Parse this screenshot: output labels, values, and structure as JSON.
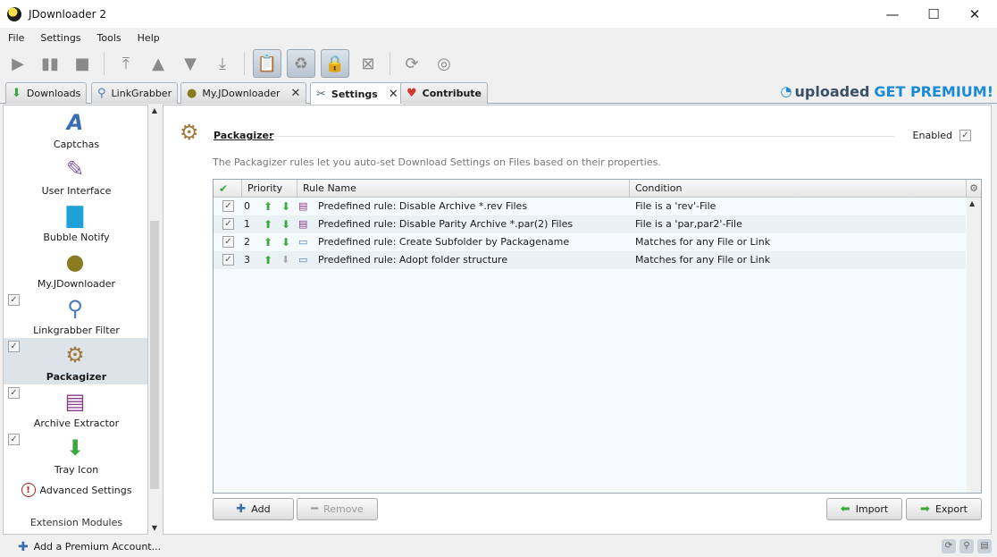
{
  "window": {
    "title": "JDownloader 2",
    "minimize": "—",
    "maximize": "☐",
    "close": "✕"
  },
  "menu": [
    "File",
    "Settings",
    "Tools",
    "Help"
  ],
  "tabs": [
    {
      "label": "Downloads",
      "icon": "download-arrow-icon"
    },
    {
      "label": "LinkGrabber",
      "icon": "magnifier-icon"
    },
    {
      "label": "My.JDownloader",
      "icon": "myjd-icon",
      "closable": true
    },
    {
      "label": "Settings",
      "icon": "wrench-icon",
      "closable": true,
      "active": true
    },
    {
      "label": "Contribute",
      "icon": "heart-icon"
    }
  ],
  "promo": {
    "brand": "uploaded",
    "cta": "GET PREMIUM!"
  },
  "sidebar": {
    "items": [
      {
        "label": "Captchas",
        "icon": "captcha-icon",
        "checkable": false
      },
      {
        "label": "User Interface",
        "icon": "paint-brush-icon",
        "checkable": false
      },
      {
        "label": "Bubble Notify",
        "icon": "speech-bubble-icon",
        "checkable": false
      },
      {
        "label": "My.JDownloader",
        "icon": "myjd-icon",
        "checkable": false
      },
      {
        "label": "Linkgrabber Filter",
        "icon": "filter-icon",
        "checkable": true
      },
      {
        "label": "Packagizer",
        "icon": "packagizer-icon",
        "checkable": true,
        "selected": true
      },
      {
        "label": "Archive Extractor",
        "icon": "archive-icon",
        "checkable": true
      },
      {
        "label": "Tray Icon",
        "icon": "tray-icon",
        "checkable": true
      }
    ],
    "advanced": "Advanced Settings",
    "extensions": "Extension Modules"
  },
  "panel": {
    "title": "Packagizer",
    "enabled_label": "Enabled",
    "description": "The Packagizer rules let you auto-set Download Settings on Files based on their properties."
  },
  "table": {
    "columns": [
      "Priority",
      "Rule Name",
      "Condition"
    ],
    "rows": [
      {
        "priority": "0",
        "name": "Predefined rule: Disable Archive *.rev Files",
        "condition": "File is a 'rev'-File",
        "icon": "archive-icon"
      },
      {
        "priority": "1",
        "name": "Predefined rule: Disable Parity Archive *.par(2) Files",
        "condition": "File is a 'par,par2'-File",
        "icon": "archive-icon"
      },
      {
        "priority": "2",
        "name": "Predefined rule: Create Subfolder by Packagename",
        "condition": "Matches for any File or Link",
        "icon": "folder-icon"
      },
      {
        "priority": "3",
        "name": "Predefined rule: Adopt folder structure",
        "condition": "Matches for any File or Link",
        "icon": "folder-icon"
      }
    ]
  },
  "buttons": {
    "add": "Add",
    "remove": "Remove",
    "import": "Import",
    "export": "Export"
  },
  "status": {
    "add_premium": "Add a Premium Account..."
  }
}
